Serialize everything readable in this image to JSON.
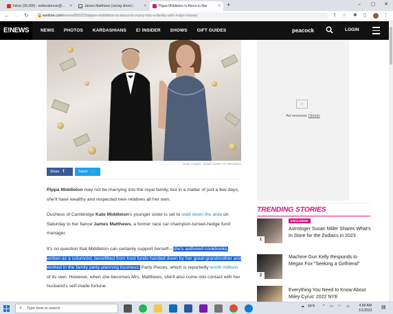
{
  "browser": {
    "tabs": [
      {
        "title": "Inbox (36,430) - wellesdonner@...",
        "active": false,
        "fav_color": "#d93025"
      },
      {
        "title": "James Matthews (racing driver) -",
        "active": false,
        "fav_color": "#555555"
      },
      {
        "title": "Pippa Middleton Is About to Mar",
        "active": true,
        "fav_color": "#d8157d"
      }
    ],
    "new_tab": "+",
    "url_domain": "eonline.com",
    "url_path": "/news/850223/pippa-middleton-is-about-to-marry-into-a-family-with-major-money"
  },
  "site": {
    "logo": "E!NEWS",
    "menu": [
      "NEWS",
      "PHOTOS",
      "KARDASHIANS",
      "E! INSIDER",
      "SHOWS",
      "GIFT GUIDES"
    ],
    "peacock": "peacock",
    "login": "LOGIN"
  },
  "article": {
    "photo_caption": "Getty Images; Splash News / E! Illustration",
    "share_label": "Share",
    "tweet_label": "Tweet",
    "p1_bold": "Pippa Middleton",
    "p1_rest": " may not be marrying into the royal family, but in a matter of just a few days, she'll have wealthy and respected new relatives all her own.",
    "p2_a": "Duchess of Cambridge ",
    "p2_bold1": "Kate Middleton",
    "p2_b": "'s younger sister is set to ",
    "p2_link": "walk down the aisle",
    "p2_c": " on Saturday to her fiancé ",
    "p2_bold2": "James Matthews",
    "p2_d": ", a former race car champion-turned-hedge fund manager.",
    "p3_a": "It's no question that Middleton can certainly support herself—",
    "p3_highlight": "she's authored cookbooks, written as a columnist, benefitted from trust funds handed down by her great-grandmother and worked in the family party-planning business.",
    "p3_b": " Party Pieces, which is reportedly ",
    "p3_link": "worth millions",
    "p3_c": " of its own. However, when she becomes Mrs. Matthews, she'll also come into contact with her husband's self-made fortune."
  },
  "sidebar": {
    "ad_removed": "Ad removed.",
    "ad_details": "Details",
    "trending_heading": "TRENDING STORIES",
    "stories": [
      {
        "num": "1",
        "badge": "EXCLUSIVE",
        "title": "Astrologer Susan Miller Shares What's In Store for the Zodiacs in 2023"
      },
      {
        "num": "2",
        "badge": "",
        "title": "Machine Gun Kelly Responds to Megan Fox \"Seeking a Girlfriend\""
      },
      {
        "num": "3",
        "badge": "",
        "title": "Everything You Need to Know About Miley Cyrus' 2022 NYE"
      }
    ]
  },
  "taskbar": {
    "search_placeholder": "Type here to search",
    "weather": "50°F",
    "time": "4:58 AM",
    "date": "1/1/2023"
  },
  "colors": {
    "accent": "#d8157d",
    "link": "#2a86c8",
    "selection": "#1a62d6"
  }
}
